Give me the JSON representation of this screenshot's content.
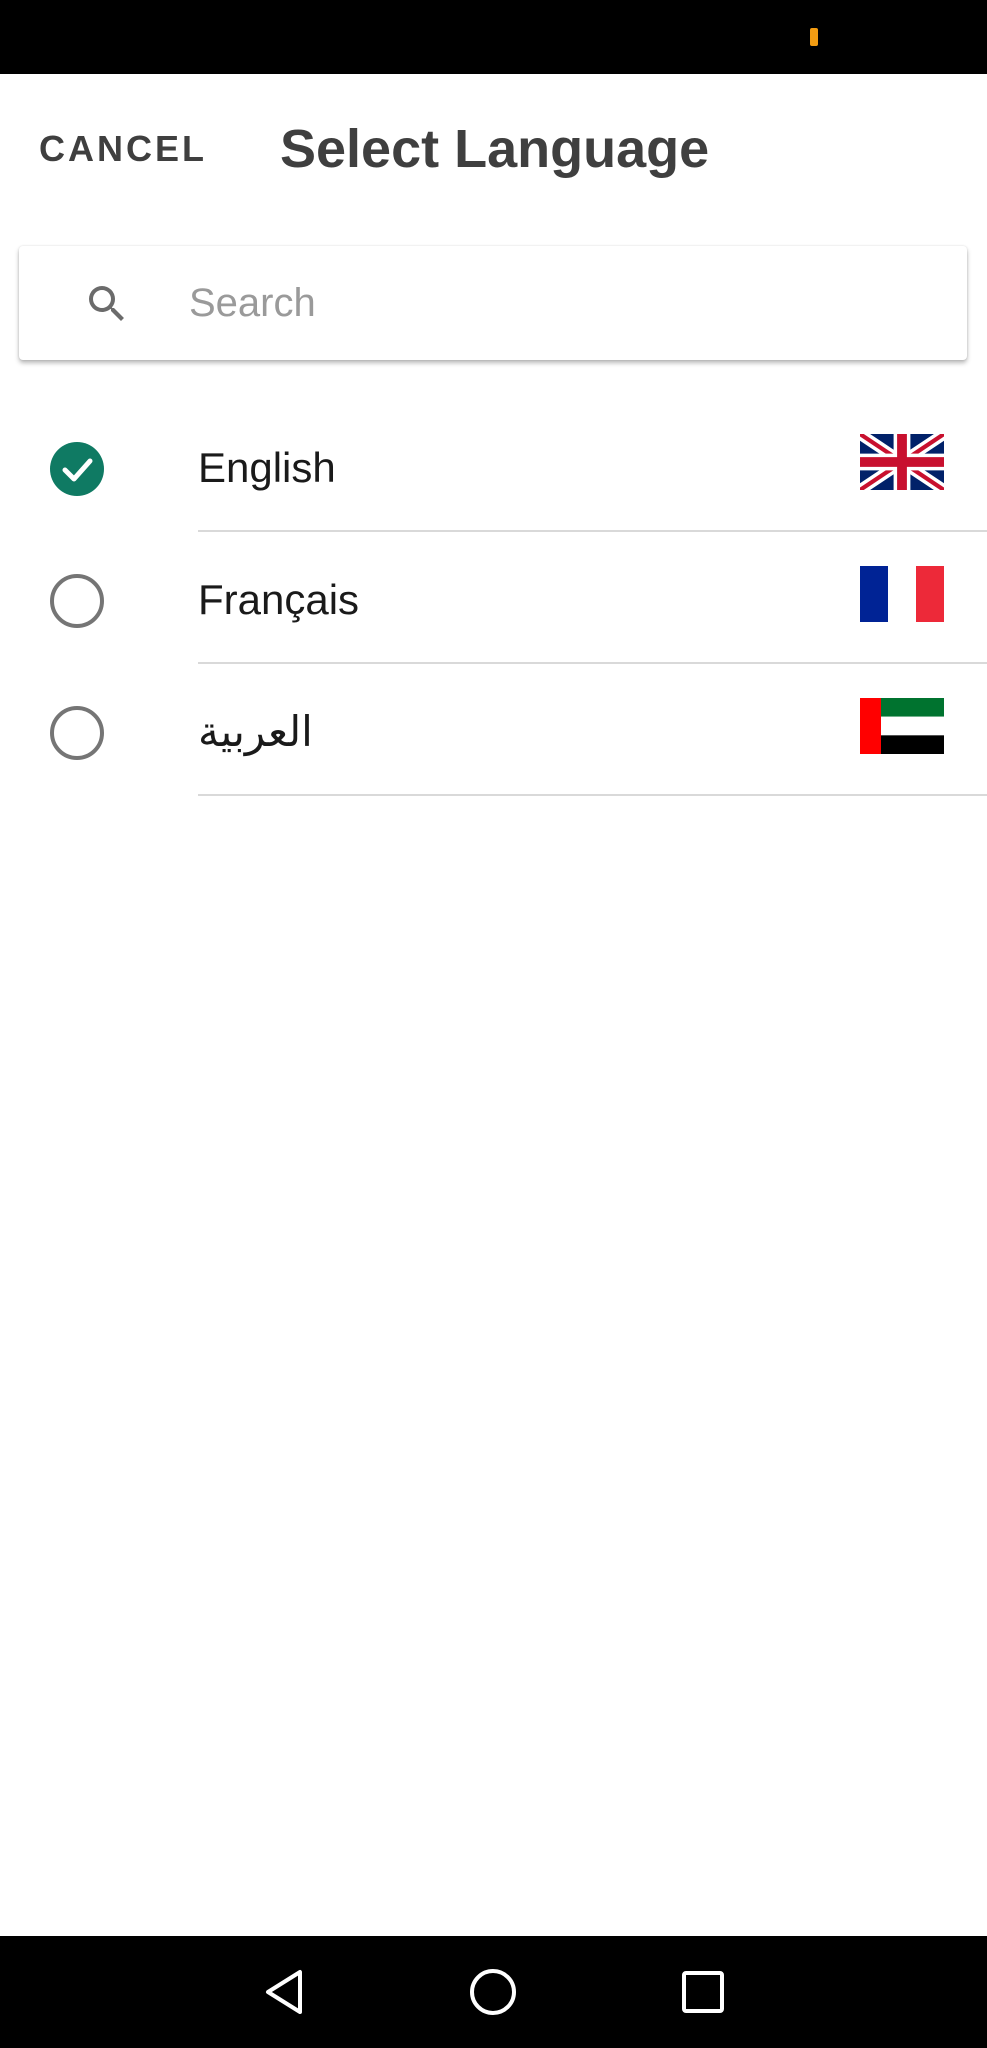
{
  "status_bar": {
    "indicator_color": "#f39c12"
  },
  "header": {
    "cancel_label": "CANCEL",
    "title": "Select Language"
  },
  "search": {
    "placeholder": "Search",
    "value": ""
  },
  "languages": [
    {
      "label": "English",
      "selected": true,
      "flag": "uk-flag-icon"
    },
    {
      "label": "Français",
      "selected": false,
      "flag": "france-flag-icon"
    },
    {
      "label": "العربية",
      "selected": false,
      "flag": "uae-flag-icon"
    }
  ],
  "colors": {
    "accent": "#0f7a63",
    "text_primary": "#1a1a1a",
    "text_header": "#3f3f3f",
    "divider": "#d9d9d9"
  },
  "nav_bar": {
    "icons": [
      "back-icon",
      "home-icon",
      "recents-icon"
    ]
  }
}
